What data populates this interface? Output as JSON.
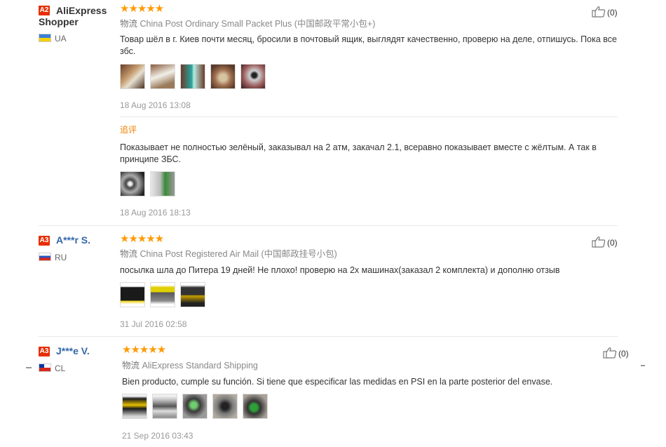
{
  "reviews": [
    {
      "level": "A2",
      "user": "AliExpress Shopper",
      "user_line1": "AliExpress",
      "user_line2": "Shopper",
      "country": "UA",
      "stars": "★★★★★",
      "shipping_label": "物流",
      "shipping": "China Post Ordinary Small Packet Plus (中国邮政平常小包+)",
      "text_line1": "Товар шёл в г. Киев почти месяц, бросили в почтовый ящик, выглядят качественно, проверю на деле, отпишусь. Пока все",
      "text_line2": "збс.",
      "date": "18 Aug 2016 13:08",
      "additional_label": "追评",
      "additional_line1": "Показывает не полностью зелёный, заказывал на 2 атм, закачал 2.1, всеравно показывает вместе с жёлтым. А так в",
      "additional_line2": "принципе ЗБС.",
      "additional_date": "18 Aug 2016 18:13",
      "likes": "(0)"
    },
    {
      "level": "A3",
      "user": "A***r S.",
      "country": "RU",
      "stars": "★★★★★",
      "shipping_label": "物流",
      "shipping": "China Post Registered Air Mail (中国邮政挂号小包)",
      "text": "посылка шла до Питера 19 дней! Не плохо! проверю на 2х машинах(заказал 2 комплекта) и дополню отзыв",
      "date": "31 Jul 2016 02:58",
      "likes": "(0)"
    },
    {
      "level": "A3",
      "user": "J***e V.",
      "country": "CL",
      "stars": "★★★★★",
      "shipping_label": "物流",
      "shipping": "AliExpress Standard Shipping",
      "text": "Bien producto, cumple su función. Si tiene que especificar las medidas en PSI en la parte posterior del envase.",
      "date": "21 Sep 2016 03:43",
      "likes": "(0)"
    }
  ],
  "colors": {
    "stars": "#ff9a00",
    "badge": "#e62e04",
    "username_blue": "#3366aa",
    "additional_label": "#f08200"
  },
  "icons": [
    "thumbs-up-icon",
    "flag-icon",
    "star-icon"
  ]
}
